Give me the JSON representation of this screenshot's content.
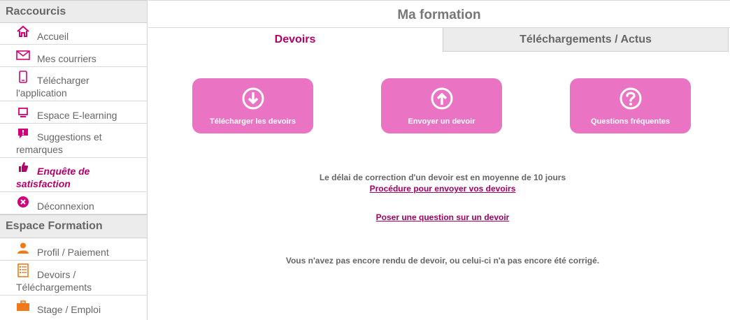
{
  "sidebar": {
    "section_raccourcis": "Raccourcis",
    "section_formation": "Espace Formation",
    "items_raccourcis": [
      {
        "label": "Accueil",
        "icon": "home-icon"
      },
      {
        "label": "Mes courriers",
        "icon": "envelope-icon"
      },
      {
        "label": "Télécharger",
        "label2": "l'application",
        "icon": "phone-icon"
      },
      {
        "label": "Espace E-learning",
        "icon": "monitor-icon"
      },
      {
        "label": "Suggestions et",
        "label2": "remarques",
        "icon": "comment-alert-icon"
      },
      {
        "label": "Enquête de",
        "label2": "satisfaction",
        "icon": "thumbs-up-icon"
      },
      {
        "label": "Déconnexion",
        "icon": "close-circle-icon"
      }
    ],
    "items_formation": [
      {
        "label": "Profil / Paiement",
        "icon": "user-icon"
      },
      {
        "label": "Devoirs /",
        "label2": "Téléchargements",
        "icon": "document-list-icon"
      },
      {
        "label": "Stage / Emploi",
        "icon": "briefcase-icon"
      }
    ]
  },
  "main": {
    "title": "Ma formation",
    "tabs": [
      {
        "label": "Devoirs"
      },
      {
        "label": "Téléchargements / Actus"
      }
    ],
    "buttons": [
      {
        "label": "Télécharger les devoirs",
        "icon": "download-circle-icon"
      },
      {
        "label": "Envoyer un devoir",
        "icon": "upload-circle-icon"
      },
      {
        "label": "Questions fréquentes",
        "icon": "question-circle-icon"
      }
    ],
    "delai_text": "Le délai de correction d'un devoir est en moyenne de 10 jours",
    "procedure_link": "Procédure pour envoyer vos devoirs",
    "question_link": "Poser une question sur un devoir",
    "no_devoir_text": "Vous n'avez pas encore rendu de devoir, ou celui-ci n'a pas encore été corrigé."
  },
  "colors": {
    "accent": "#b4006a",
    "button_pink": "#ea74c3",
    "icon_pink": "#d4007a",
    "icon_orange": "#f07a1a"
  }
}
